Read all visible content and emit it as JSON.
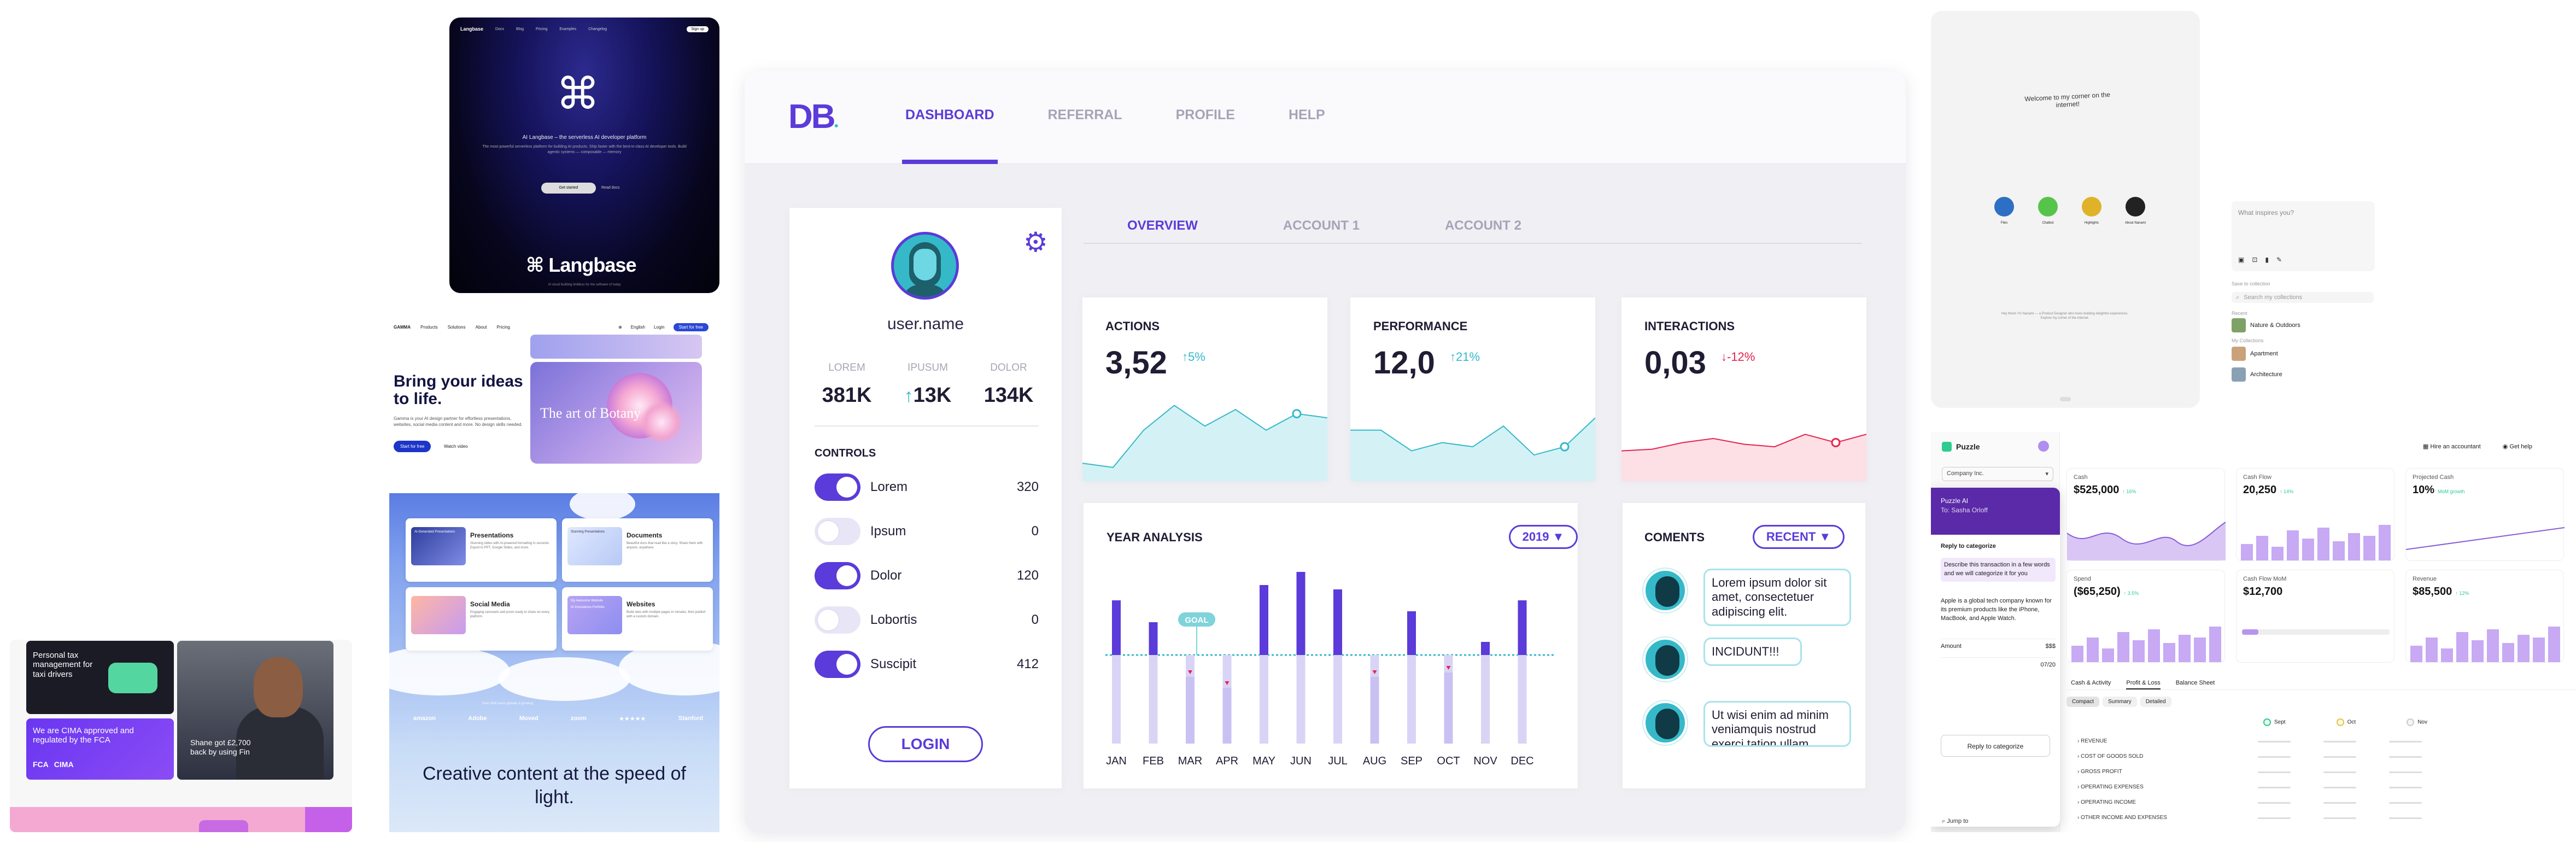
{
  "langbase": {
    "nav": [
      "Langbase",
      "Docs",
      "Blog",
      "Pricing",
      "Examples",
      "Changelog",
      "Pricing"
    ],
    "signup": "Sign up",
    "headline": "AI Langbase – the serverless AI developer platform",
    "sub": "The most powerful serverless platform for building AI products. Ship faster with the best-in-class AI developer tools. Build agentic systems — composable — memory",
    "btn1": "Get started",
    "btn2": "Read docs",
    "brand": "Langbase",
    "foot": "AI cloud building limitless for the software of today"
  },
  "gamma": {
    "logo": "GAMMA",
    "nav": [
      "Products",
      "Solutions",
      "About",
      "Pricing"
    ],
    "right": [
      "English",
      "Login"
    ],
    "signup": "Start for free",
    "headline": "Bring your ideas to life.",
    "para": "Gamma is your AI design partner for effortless presentations, websites, social media content and more. No design skills needed.",
    "btn1": "Start for free",
    "btn2": "Watch video",
    "art": "The art of Botany",
    "tiles": [
      {
        "title": "Presentations",
        "desc": "Stunning slides with AI-powered formatting in seconds. Export to PPT, Google Slides, and more."
      },
      {
        "title": "Documents",
        "desc": "Beautiful docs that read like a story. Share them with anyone, anywhere."
      },
      {
        "title": "Social Media",
        "desc": "Engaging carousels and posts ready to share on every platform."
      },
      {
        "title": "Websites",
        "desc": "Build sites with multiple pages in minutes, then publish with a custom domain."
      }
    ],
    "tile_labels": [
      "AI-Generated Presentations",
      "Stunning Presentations",
      "My Awesome Website",
      "AI Innovations Portfolio"
    ],
    "logos_text": "Over 50M users globally & growing",
    "logos": [
      "amazon",
      "Adobe",
      "Moved",
      "zoom",
      "★★★★★",
      "Stanford"
    ],
    "tagline": "Creative content at the speed of light."
  },
  "fintech": {
    "c1": "Personal tax management for taxi drivers",
    "c2": "We are CIMA approved and regulated by the FCA",
    "c2_tags": [
      "FCA",
      "CIMA"
    ],
    "c3": "Shane got £2,700 back by using Fin"
  },
  "db": {
    "logo": "DB",
    "tabs": [
      {
        "label": "DASHBOARD",
        "active": true
      },
      {
        "label": "REFERRAL",
        "active": false
      },
      {
        "label": "PROFILE",
        "active": false
      },
      {
        "label": "HELP",
        "active": false
      }
    ],
    "username": "user.name",
    "stats": [
      {
        "k": "LOREM",
        "v": "381K",
        "up": false
      },
      {
        "k": "IPUSUM",
        "v": "13K",
        "up": true
      },
      {
        "k": "DOLOR",
        "v": "134K",
        "up": false
      }
    ],
    "controls_title": "CONTROLS",
    "controls": [
      {
        "label": "Lorem",
        "value": "320",
        "on": true
      },
      {
        "label": "Ipsum",
        "value": "0",
        "on": false
      },
      {
        "label": "Dolor",
        "value": "120",
        "on": true
      },
      {
        "label": "Lobortis",
        "value": "0",
        "on": false
      },
      {
        "label": "Suscipit",
        "value": "412",
        "on": true
      }
    ],
    "login": "LOGIN",
    "subtabs": [
      {
        "label": "OVERVIEW",
        "active": true
      },
      {
        "label": "ACCOUNT 1",
        "active": false
      },
      {
        "label": "ACCOUNT 2",
        "active": false
      }
    ],
    "kpis": [
      {
        "title": "ACTIONS",
        "value": "3,52",
        "delta": "↑5%",
        "color": "#35b9c9",
        "fill": "#d4f2f5",
        "trend": [
          0.15,
          0.1,
          0.55,
          0.85,
          0.6,
          0.8,
          0.55,
          0.75,
          0.7
        ]
      },
      {
        "title": "PERFORMANCE",
        "value": "12,0",
        "delta": "↑21%",
        "color": "#35b9c9",
        "fill": "#d4f2f5",
        "trend": [
          0.55,
          0.55,
          0.3,
          0.4,
          0.35,
          0.6,
          0.25,
          0.35,
          0.7
        ]
      },
      {
        "title": "INTERACTIONS",
        "value": "0,03",
        "delta": "↓-12%",
        "color": "#e4244e",
        "fill": "#fde0e6",
        "trend": [
          0.3,
          0.32,
          0.4,
          0.45,
          0.38,
          0.35,
          0.5,
          0.4,
          0.5
        ]
      }
    ],
    "year_title": "YEAR ANALYSIS",
    "year_select": "2019 ▼",
    "goal": "GOAL",
    "chart_data": {
      "type": "bar",
      "title": "YEAR ANALYSIS",
      "categories": [
        "JAN",
        "FEB",
        "MAR",
        "APR",
        "MAY",
        "JUN",
        "JUL",
        "AUG",
        "SEP",
        "OCT",
        "NOV",
        "DEC"
      ],
      "values": [
        12.5,
        7.5,
        -5,
        -7.5,
        16,
        19,
        15,
        -5,
        10,
        -4,
        3,
        12.5
      ],
      "goal": 0,
      "ylim": [
        -20,
        20
      ]
    },
    "comments_title": "COMENTS",
    "comments_select": "RECENT ▼",
    "comments": [
      "Lorem ipsum dolor sit amet, consectetuer adipiscing elit.",
      "INCIDUNT!!!",
      "Ut wisi enim ad minim veniamquis nostrud exerci tation ullam"
    ]
  },
  "rt1": {
    "welcome": "Welcome to my corner on the internet!",
    "icons": [
      "Files",
      "Chatbot",
      "Highlights",
      "About Nanami"
    ],
    "foot": "Hey there! I'm Nanami — a Product Designer who loves building delightful experiences. Explore my corner of the internet."
  },
  "rt2": {
    "prompt": "What inspires you?",
    "save": "Save to collection",
    "search": "Search my collections",
    "recent": "Recent",
    "c1": "Nature & Outdoors",
    "mine": "My Collections",
    "c2": "Apartment",
    "c3": "Architecture"
  },
  "puzzle": {
    "brand": "Puzzle",
    "company": "Company Inc.",
    "ai_title": "Puzzle AI",
    "ai_to": "To: Sasha Orloff",
    "ai_lines": [
      "Reply to categorize",
      "Describe this transaction in a few words and we will categorize it for you",
      "Apple is a global tech company known for its premium products like the iPhone, MacBook, and Apple Watch."
    ],
    "amount_label": "Amount",
    "amount_val": "$$$",
    "date_val": "07/20",
    "reply": "Reply to categorize",
    "jump": "Jump to",
    "hire": "Hire an accountant",
    "help": "Get help",
    "metrics": [
      {
        "t": "Cash",
        "v": "$525,000",
        "d": "↑ 16%"
      },
      {
        "t": "Cash Flow",
        "v": "20,250",
        "d": "↑ 14%"
      },
      {
        "t": "Projected Cash",
        "v": "10%",
        "d": "MoM growth"
      },
      {
        "t": "Spend",
        "v": "($65,250)",
        "d": "↑ 3.5%"
      },
      {
        "t": "Cash Flow MoM",
        "v": "$12,700",
        "d": ""
      },
      {
        "t": "Revenue",
        "v": "$85,500",
        "d": "↑ 12%"
      }
    ],
    "tabs": [
      "Cash & Activity",
      "Profit & Loss",
      "Balance Sheet"
    ],
    "pills": [
      "Compact",
      "Summary",
      "Detailed"
    ],
    "cols": [
      "Sept",
      "Oct",
      "Nov"
    ],
    "rows": [
      "REVENUE",
      "COST OF GOODS SOLD",
      "GROSS PROFIT",
      "OPERATING EXPENSES",
      "OPERATING INCOME",
      "OTHER INCOME AND EXPENSES"
    ]
  }
}
